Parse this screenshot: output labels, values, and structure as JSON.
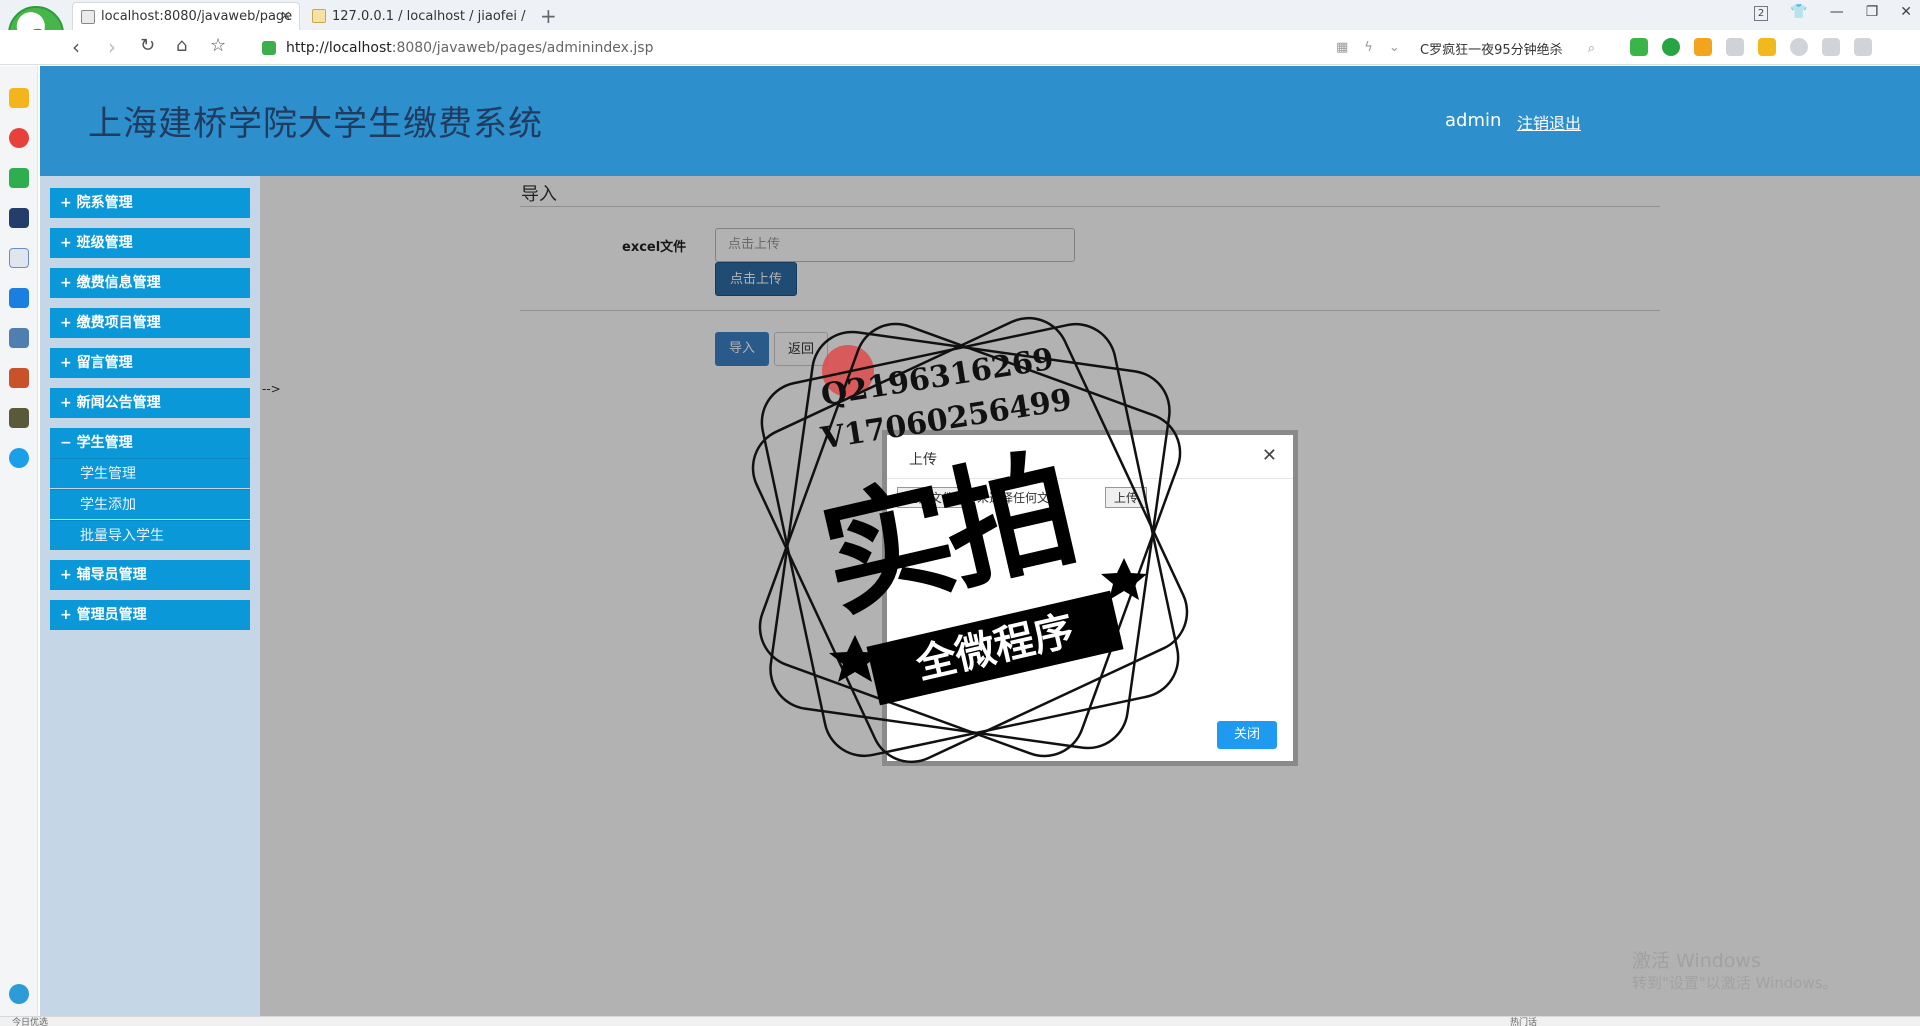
{
  "browser": {
    "tabs": [
      {
        "label": "localhost:8080/javaweb/page"
      },
      {
        "label": "127.0.0.1 / localhost / jiaofei /"
      }
    ],
    "tab_count": "2",
    "url_host": "http://localhost",
    "url_path": ":8080/javaweb/pages/adminindex.jsp",
    "search_text": "C罗疯狂一夜95分钟绝杀"
  },
  "app": {
    "title": "上海建桥学院大学生缴费系统",
    "user": "admin",
    "logout": "注销退出"
  },
  "nav": {
    "groups": [
      {
        "label": "+ 院系管理"
      },
      {
        "label": "+ 班级管理"
      },
      {
        "label": "+ 缴费信息管理"
      },
      {
        "label": "+ 缴费项目管理"
      },
      {
        "label": "+ 留言管理"
      },
      {
        "label": "+ 新闻公告管理"
      },
      {
        "label": "− 学生管理"
      },
      {
        "label": "+ 辅导员管理"
      },
      {
        "label": "+ 管理员管理"
      }
    ],
    "subitems": [
      {
        "label": "学生管理"
      },
      {
        "label": "学生添加"
      },
      {
        "label": "批量导入学生"
      }
    ]
  },
  "main": {
    "section_title": "导入",
    "excel_label": "excel文件",
    "file_placeholder": "点击上传",
    "upload_button": "点击上传",
    "import_button": "导入",
    "back_button": "返回",
    "arrow_text": "-->"
  },
  "modal": {
    "title": "上传",
    "choose_file": "选择文件",
    "no_file": "未选择任何文件",
    "upload": "上传",
    "close_button": "关闭"
  },
  "watermark": {
    "qq": "Q2196316269",
    "vx": "V17060256499",
    "big": "实拍",
    "banner": "全微程序"
  },
  "windows": {
    "activate_line1": "激活 Windows",
    "activate_line2": "转到\"设置\"以激活 Windows。"
  },
  "statusbar": {
    "left": "今日优选",
    "right": "热门话"
  }
}
